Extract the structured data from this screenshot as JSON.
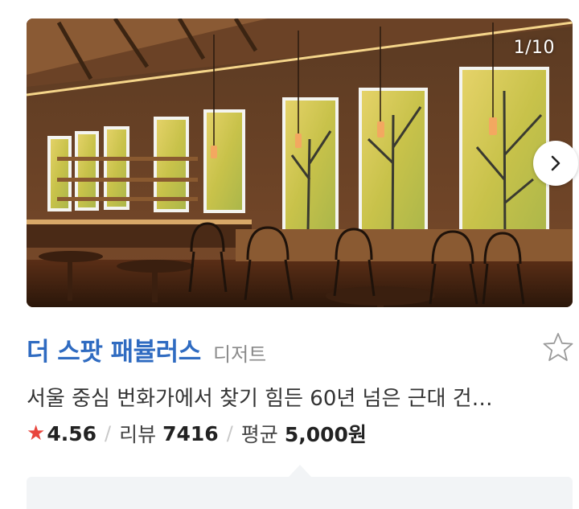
{
  "photo": {
    "counter": "1/10",
    "alt": "cafe interior photo"
  },
  "place": {
    "name": "더 스팟 패뷸러스",
    "category": "디저트",
    "description": "서울 중심 번화가에서 찾기 힘든 60년 넘은 근대 건…"
  },
  "stats": {
    "rating": "4.56",
    "review_label": "리뷰",
    "review_count": "7416",
    "price_label": "평균",
    "price_value": "5,000원",
    "separator": "/"
  },
  "icons": {
    "next": "chevron-right-icon",
    "favorite": "star-outline-icon",
    "rating": "star-filled-icon"
  },
  "colors": {
    "title": "#2f6bc1",
    "rating_star": "#e8453c",
    "panel": "#f2f4f6"
  }
}
